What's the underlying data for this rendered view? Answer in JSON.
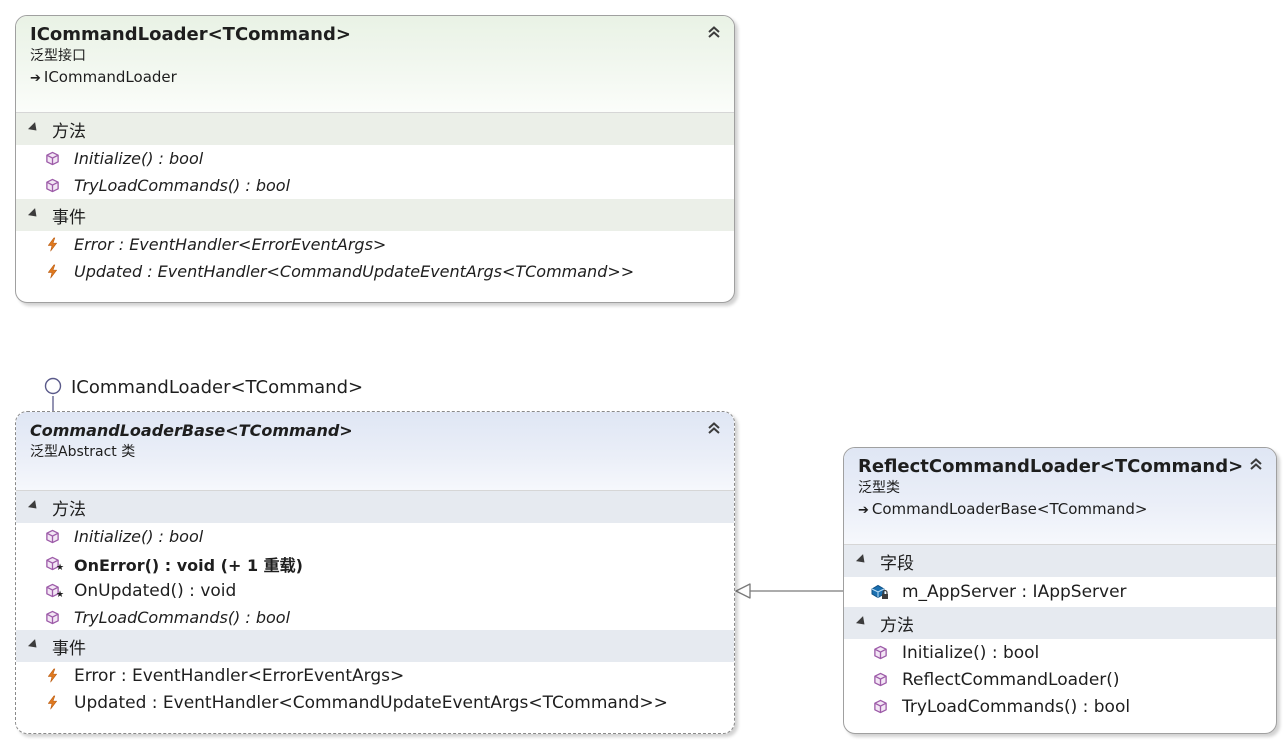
{
  "interface_box": {
    "title": "ICommandLoader<TCommand>",
    "stereotype": "泛型接口",
    "inherits": "ICommandLoader",
    "sections": {
      "methods_title": "方法",
      "methods": [
        "Initialize() : bool",
        "TryLoadCommands() : bool"
      ],
      "events_title": "事件",
      "events": [
        "Error : EventHandler<ErrorEventArgs>",
        "Updated : EventHandler<CommandUpdateEventArgs<TCommand>>"
      ]
    }
  },
  "abstract_box": {
    "implements_label": "ICommandLoader<TCommand>",
    "title": "CommandLoaderBase<TCommand>",
    "stereotype": "泛型Abstract 类",
    "sections": {
      "methods_title": "方法",
      "methods": [
        "Initialize() : bool",
        "OnError() : void (+ 1 重载)",
        "OnUpdated() : void",
        "TryLoadCommands() : bool"
      ],
      "events_title": "事件",
      "events": [
        "Error : EventHandler<ErrorEventArgs>",
        "Updated : EventHandler<CommandUpdateEventArgs<TCommand>>"
      ]
    }
  },
  "concrete_box": {
    "title": "ReflectCommandLoader<TCommand>",
    "stereotype": "泛型类",
    "inherits": "CommandLoaderBase<TCommand>",
    "sections": {
      "fields_title": "字段",
      "fields": [
        "m_AppServer : IAppServer"
      ],
      "methods_title": "方法",
      "methods": [
        "Initialize() : bool",
        "ReflectCommandLoader()",
        "TryLoadCommands() : bool"
      ]
    }
  },
  "icons": {
    "method": "method-cube-icon",
    "protected_method": "protected-method-icon",
    "event": "event-lightning-icon",
    "private_field": "private-field-icon",
    "collapse": "double-chevron-up-icon",
    "section_toggle": "section-expanded-triangle-icon"
  },
  "colors": {
    "method_icon": "#9d5ba8",
    "event_icon": "#e07a1f",
    "field_icon": "#1a6fb0"
  }
}
